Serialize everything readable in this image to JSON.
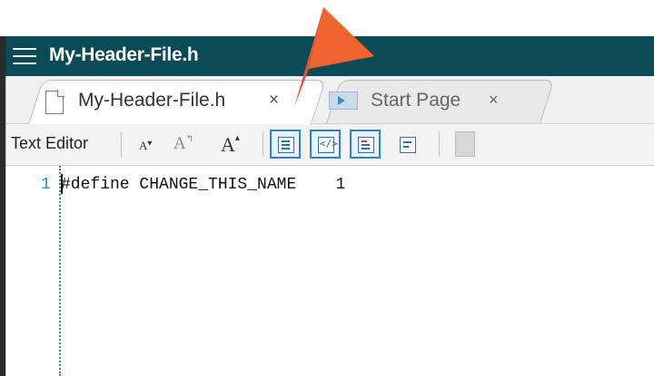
{
  "window": {
    "title": "My-Header-File.h"
  },
  "tabs": [
    {
      "label": "My-Header-File.h",
      "close": "×",
      "active": true,
      "icon": "file-icon"
    },
    {
      "label": "Start Page",
      "close": "×",
      "active": false,
      "icon": "start-page-icon"
    }
  ],
  "toolbar": {
    "label": "Text Editor",
    "font_decrease": "A",
    "font_reset": "A",
    "font_increase": "A",
    "buttons": [
      {
        "name": "line-numbers-icon",
        "active": true
      },
      {
        "name": "code-view-icon",
        "active": true
      },
      {
        "name": "highlight-icon",
        "active": true
      },
      {
        "name": "word-wrap-icon",
        "active": false
      },
      {
        "name": "document-icon",
        "active": false
      }
    ]
  },
  "editor": {
    "lines": [
      {
        "number": "1",
        "text": "#define CHANGE_THIS_NAME    1"
      }
    ]
  },
  "colors": {
    "titlebar": "#0b4b57",
    "accent": "#2d7fd3",
    "pointer": "#e8502a",
    "line_number": "#2b91af"
  }
}
